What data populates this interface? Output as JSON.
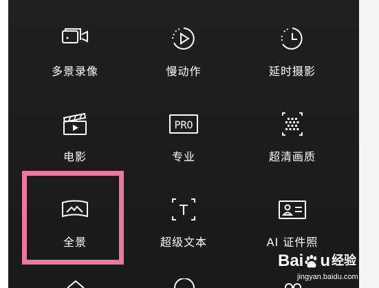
{
  "modes": [
    {
      "id": "multi-scene",
      "label": "多景录像",
      "icon": "multi-camera-icon"
    },
    {
      "id": "slow-motion",
      "label": "慢动作",
      "icon": "slow-motion-icon"
    },
    {
      "id": "time-lapse",
      "label": "延时摄影",
      "icon": "time-lapse-icon"
    },
    {
      "id": "movie",
      "label": "电影",
      "icon": "clapperboard-icon"
    },
    {
      "id": "pro",
      "label": "专业",
      "icon": "pro-icon"
    },
    {
      "id": "ultra-hd",
      "label": "超清画质",
      "icon": "ultra-hd-icon"
    },
    {
      "id": "panorama",
      "label": "全景",
      "icon": "panorama-icon"
    },
    {
      "id": "super-text",
      "label": "超级文本",
      "icon": "text-frame-icon"
    },
    {
      "id": "id-photo",
      "label": "AI 证件照",
      "icon": "id-card-icon"
    }
  ],
  "pro_icon_text": "PRO",
  "text_icon_glyph": "T",
  "highlight": {
    "target": "panorama",
    "color": "#f0789a"
  },
  "watermark": {
    "logo_left": "Bai",
    "logo_right": "u",
    "logo_suffix": "经验",
    "url": "jingyan.baidu.com"
  },
  "colors": {
    "panel_bg": "#1e1e1e",
    "text": "#ffffff"
  }
}
